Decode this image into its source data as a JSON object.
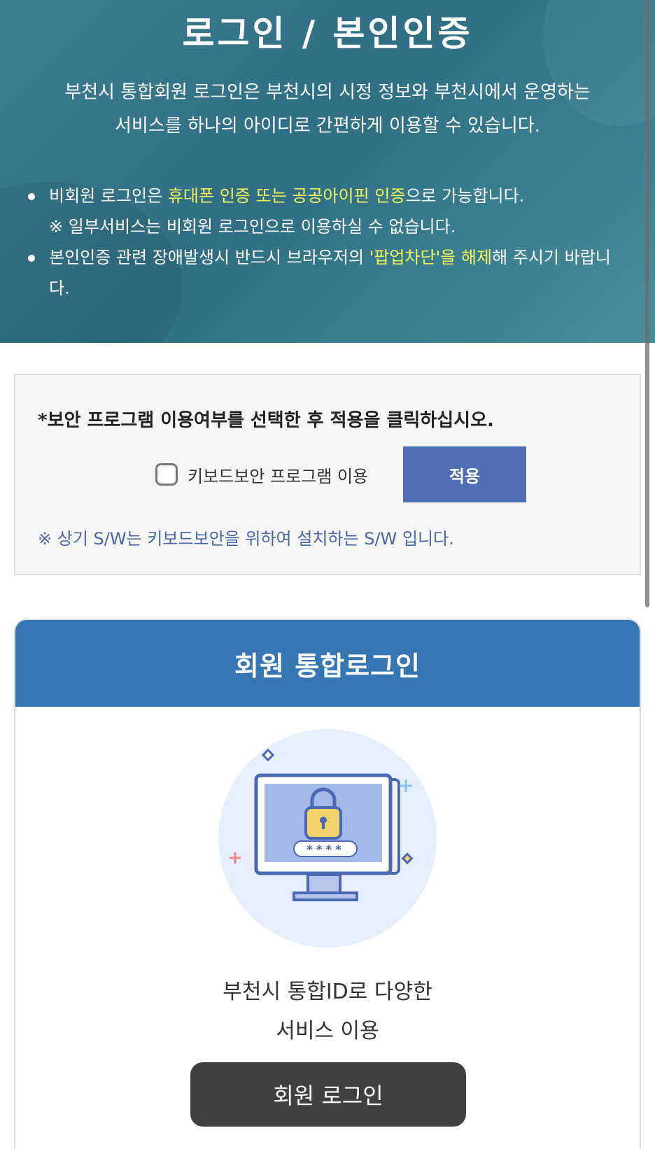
{
  "hero": {
    "title": "로그인 / 본인인증",
    "desc_line1": "부천시 통합회원 로그인은 부천시의 시정 정보와 부천시에서 운영하는",
    "desc_line2": "서비스를 하나의 아이디로 간편하게 이용할 수 있습니다.",
    "bullet1": {
      "pre": "비회원 로그인은 ",
      "highlight": "휴대폰 인증 또는 공공아이핀 인증",
      "post": "으로 가능합니다.",
      "note": "※ 일부서비스는 비회원 로그인으로 이용하실 수 없습니다."
    },
    "bullet2": {
      "pre": "본인인증 관련 장애발생시 반드시 브라우저의 ",
      "highlight1": "'팝업차단'을 해제",
      "post": "해 주시기 바랍니다."
    },
    "highlight_color": "#f2f25a"
  },
  "security": {
    "title": "*보안 프로그램 이용여부를 선택한 후 적용을 클릭하십시오.",
    "checkbox_label": "키보드보안 프로그램 이용",
    "checkbox_checked": false,
    "apply_label": "적용",
    "note": "※ 상기 S/W는 키보드보안을 위하여 설치하는 S/W 입니다."
  },
  "login_card": {
    "header": "회원 통합로그인",
    "password_mask": "****",
    "text_line1": "부천시 통합ID로 다양한",
    "text_line2": "서비스 이용",
    "button_label": "회원 로그인"
  },
  "colors": {
    "hero_bg": "#33738a",
    "apply_button": "#4f6fb2",
    "card_header": "#3576b2",
    "member_button": "#404040"
  },
  "icons": [
    "monitor-lock-illustration",
    "padlock-icon",
    "sparkle-icon"
  ]
}
